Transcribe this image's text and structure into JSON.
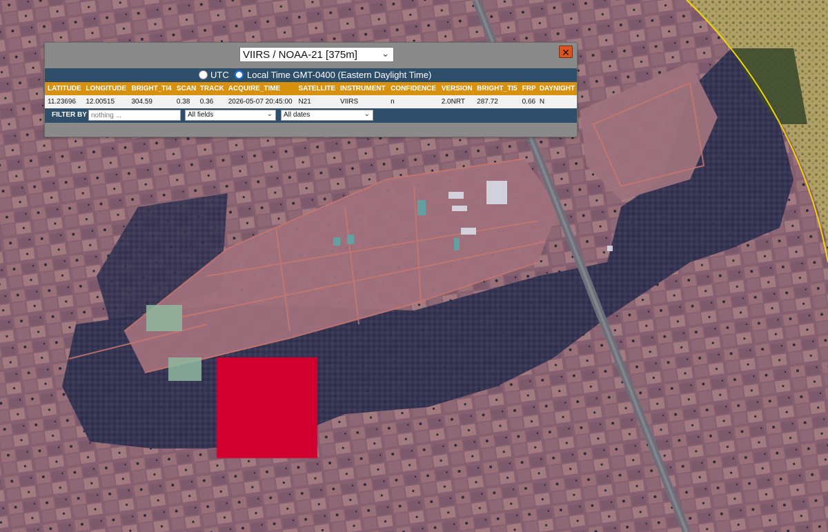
{
  "panel": {
    "satellite_select": "VIIRS / NOAA-21 [375m]",
    "close_label": "✕",
    "timezone": {
      "utc_label": "UTC",
      "local_label": "Local Time GMT-0400 (Eastern Daylight Time)",
      "selected": "local"
    },
    "table": {
      "headers": [
        "LATITUDE",
        "LONGITUDE",
        "BRIGHT_TI4",
        "SCAN",
        "TRACK",
        "ACQUIRE_TIME",
        "SATELLITE",
        "INSTRUMENT",
        "CONFIDENCE",
        "VERSION",
        "BRIGHT_TI5",
        "FRP",
        "DAYNIGHT"
      ],
      "rows": [
        [
          "11.23696",
          "12.00515",
          "304.59",
          "0.38",
          "0.36",
          "2026-05-07 20:45:00",
          "N21",
          "VIIRS",
          "n",
          "2.0NRT",
          "287.72",
          "0.66",
          "N"
        ]
      ]
    },
    "filter": {
      "label": "FILTER BY",
      "placeholder": "nothing ...",
      "fields_value": "All fields",
      "dates_value": "All dates"
    }
  },
  "colors": {
    "header_orange": "#d8900f",
    "panel_blue": "#2e4e6a",
    "close_orange": "#d9541e",
    "fire_marker_red": "#d2002e",
    "radius_circle_yellow": "#f2d600"
  }
}
